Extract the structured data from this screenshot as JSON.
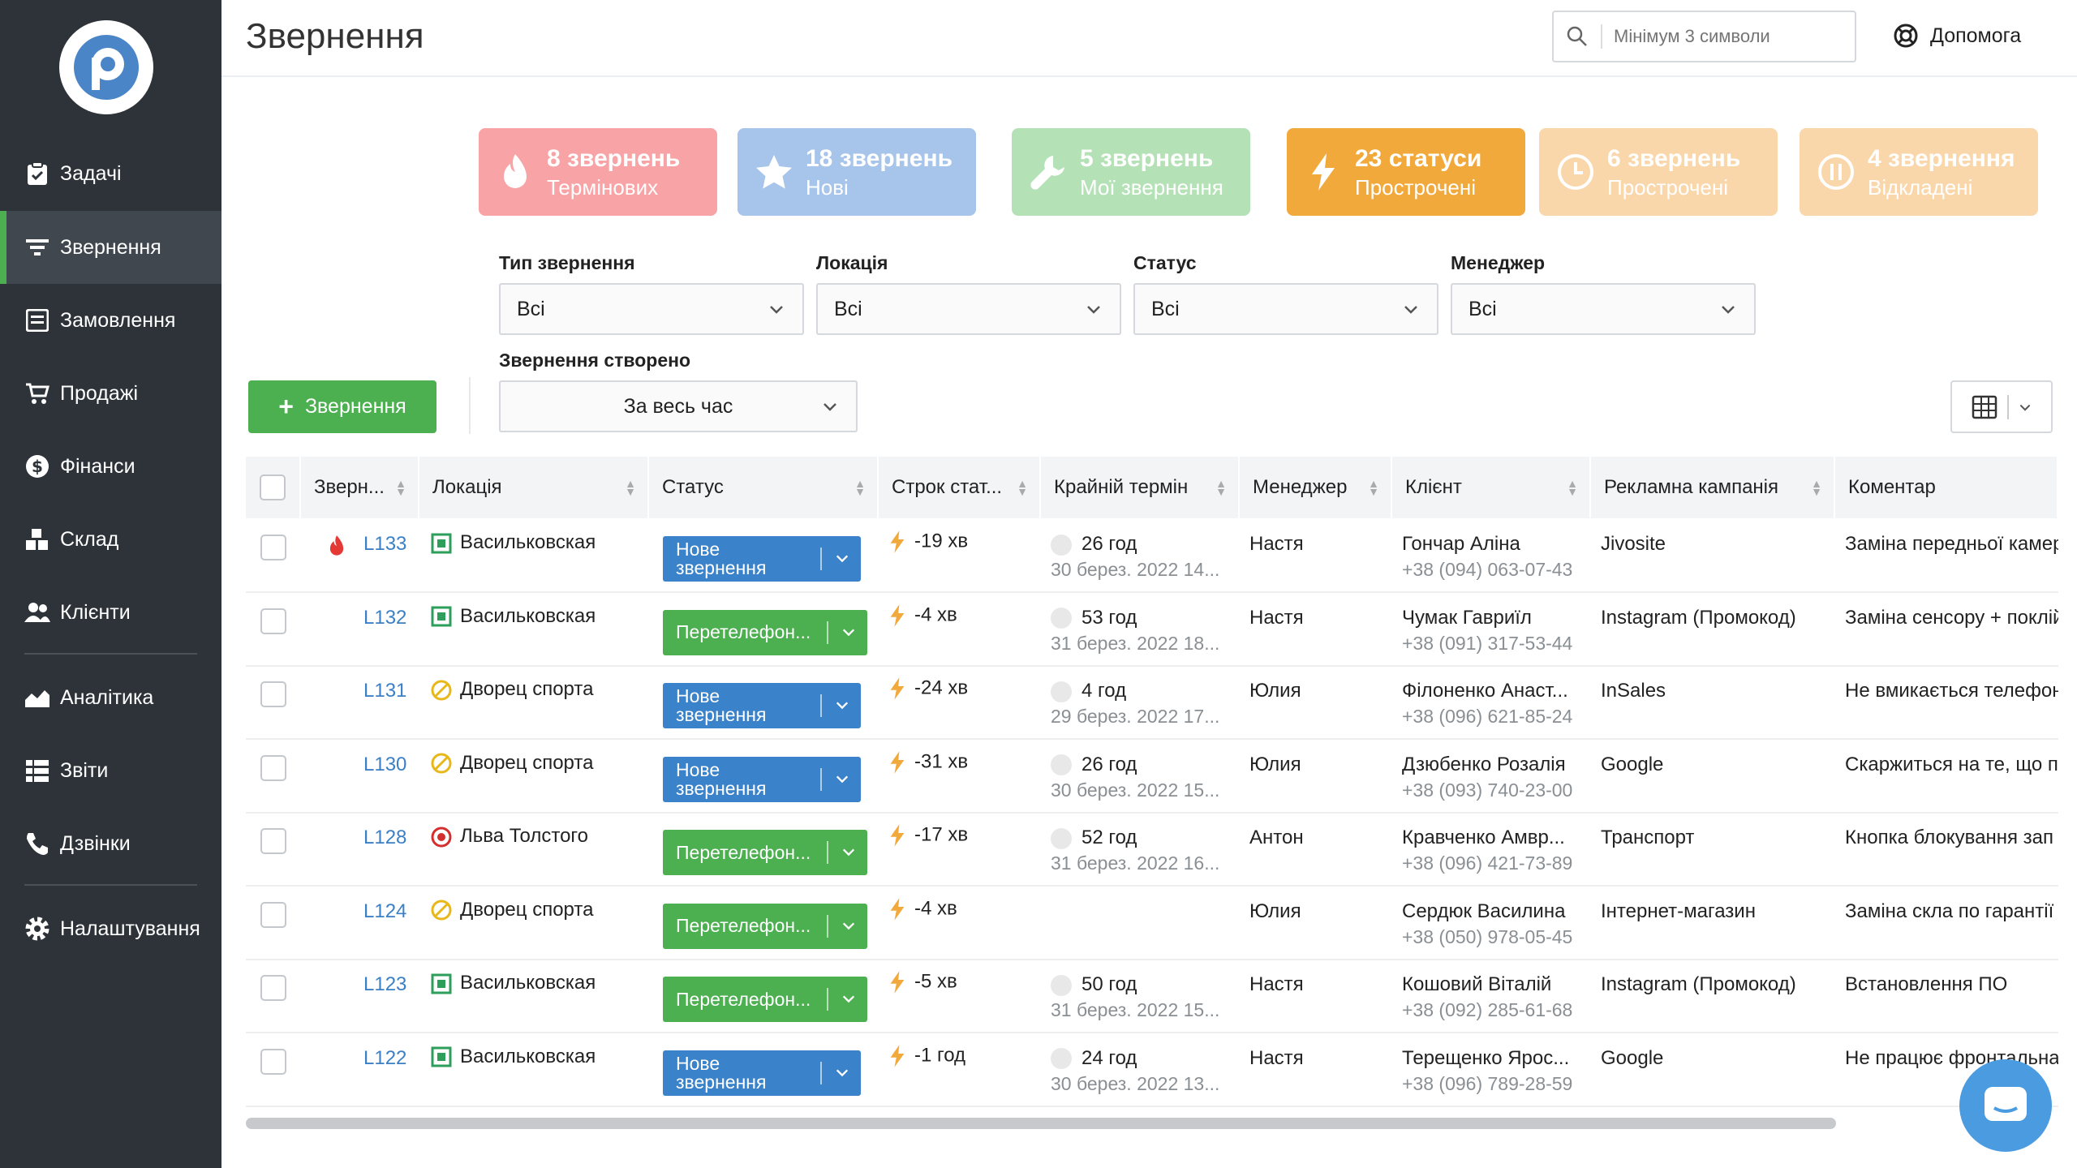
{
  "sidebar": {
    "items": [
      {
        "label": "Задачі"
      },
      {
        "label": "Звернення"
      },
      {
        "label": "Замовлення"
      },
      {
        "label": "Продажі"
      },
      {
        "label": "Фінанси"
      },
      {
        "label": "Склад"
      },
      {
        "label": "Клієнти"
      },
      {
        "label": "Аналітика"
      },
      {
        "label": "Звіти"
      },
      {
        "label": "Дзвінки"
      },
      {
        "label": "Налаштування"
      }
    ]
  },
  "header": {
    "title": "Звернення",
    "search_placeholder": "Мінімум 3 символи",
    "help_label": "Допомога"
  },
  "cards": [
    {
      "line1": "8 звернень",
      "line2": "Термінових",
      "color": "#f8a3a5",
      "icon": "flame-icon"
    },
    {
      "line1": "18 звернень",
      "line2": "Нові",
      "color": "#a7c4ea",
      "icon": "star-icon"
    },
    {
      "line1": "5 звернень",
      "line2": "Мої звернення",
      "color": "#b5e1b6",
      "icon": "wrench-icon"
    },
    {
      "line1": "23 статуси",
      "line2": "Прострочені",
      "color": "#f2a93b",
      "icon": "bolt-icon"
    },
    {
      "line1": "6 звернень",
      "line2": "Прострочені",
      "color": "#fad7ab",
      "icon": "clock-icon"
    },
    {
      "line1": "4 звернення",
      "line2": "Відкладені",
      "color": "#fad7ab",
      "icon": "pause-icon"
    }
  ],
  "filters": {
    "type_label": "Тип звернення",
    "type_value": "Всі",
    "location_label": "Локація",
    "location_value": "Всі",
    "status_label": "Статус",
    "status_value": "Всі",
    "manager_label": "Менеджер",
    "manager_value": "Всі",
    "created_label": "Звернення створено",
    "created_value": "За весь час"
  },
  "add_button_label": "Звернення",
  "table": {
    "columns": [
      "Зверн...",
      "Локація",
      "Статус",
      "Строк стат...",
      "Крайній термін",
      "Менеджер",
      "Клієнт",
      "Рекламна кампанія",
      "Коментар"
    ],
    "rows": [
      {
        "id": "L133",
        "urgent": true,
        "location": "Васильковская",
        "loc_type": "square",
        "status": "Нове звернення",
        "status_color": "blue",
        "term": "-19 хв",
        "deadline": "26 год",
        "deadline_date": "30 берез. 2022 14...",
        "manager": "Настя",
        "client": "Гончар Аліна",
        "phone": "+38 (094) 063-07-43",
        "campaign": "Jivosite",
        "comment": "Заміна передньої камер"
      },
      {
        "id": "L132",
        "urgent": false,
        "location": "Васильковская",
        "loc_type": "square",
        "status": "Перетелефон...",
        "status_color": "green",
        "term": "-4 хв",
        "deadline": "53 год",
        "deadline_date": "31 берез. 2022 18...",
        "manager": "Настя",
        "client": "Чумак Гавриїл",
        "phone": "+38 (091) 317-53-44",
        "campaign": "Instagram (Промокод)",
        "comment": "Заміна сенсору + поклій"
      },
      {
        "id": "L131",
        "urgent": false,
        "location": "Дворец спорта",
        "loc_type": "slash",
        "status": "Нове звернення",
        "status_color": "blue",
        "term": "-24 хв",
        "deadline": "4 год",
        "deadline_date": "29 берез. 2022 17...",
        "manager": "Юлия",
        "client": "Філоненко Анаст...",
        "phone": "+38 (096) 621-85-24",
        "campaign": "InSales",
        "comment": "Не вмикається телефон"
      },
      {
        "id": "L130",
        "urgent": false,
        "location": "Дворец спорта",
        "loc_type": "slash",
        "status": "Нове звернення",
        "status_color": "blue",
        "term": "-31 хв",
        "deadline": "26 год",
        "deadline_date": "30 берез. 2022 15...",
        "manager": "Юлия",
        "client": "Дзюбенко Розалія",
        "phone": "+38 (093) 740-23-00",
        "campaign": "Google",
        "comment": "Скаржиться на те, що п"
      },
      {
        "id": "L128",
        "urgent": false,
        "location": "Льва Толстого",
        "loc_type": "circle",
        "status": "Перетелефон...",
        "status_color": "green",
        "term": "-17 хв",
        "deadline": "52 год",
        "deadline_date": "31 берез. 2022 16...",
        "manager": "Антон",
        "client": "Кравченко Амвр...",
        "phone": "+38 (096) 421-73-89",
        "campaign": "Транспорт",
        "comment": "Кнопка блокування зап"
      },
      {
        "id": "L124",
        "urgent": false,
        "location": "Дворец спорта",
        "loc_type": "slash",
        "status": "Перетелефон...",
        "status_color": "green",
        "term": "-4 хв",
        "deadline": "",
        "deadline_date": "",
        "manager": "Юлия",
        "client": "Сердюк Василина",
        "phone": "+38 (050) 978-05-45",
        "campaign": "Інтернет-магазин",
        "comment": "Заміна скла по гарантії"
      },
      {
        "id": "L123",
        "urgent": false,
        "location": "Васильковская",
        "loc_type": "square",
        "status": "Перетелефон...",
        "status_color": "green",
        "term": "-5 хв",
        "deadline": "50 год",
        "deadline_date": "31 берез. 2022 15...",
        "manager": "Настя",
        "client": "Кошовий Віталій",
        "phone": "+38 (092) 285-61-68",
        "campaign": "Instagram (Промокод)",
        "comment": "Встановлення ПО"
      },
      {
        "id": "L122",
        "urgent": false,
        "location": "Васильковская",
        "loc_type": "square",
        "status": "Нове звернення",
        "status_color": "blue",
        "term": "-1 год",
        "deadline": "24 год",
        "deadline_date": "30 берез. 2022 13...",
        "manager": "Настя",
        "client": "Терещенко Ярос...",
        "phone": "+38 (096) 789-28-59",
        "campaign": "Google",
        "comment": "Не працює фронтальна"
      }
    ]
  },
  "colors": {
    "accent_green": "#4caf50",
    "link_blue": "#3b7fc4",
    "sidebar_bg": "#2d3338"
  }
}
